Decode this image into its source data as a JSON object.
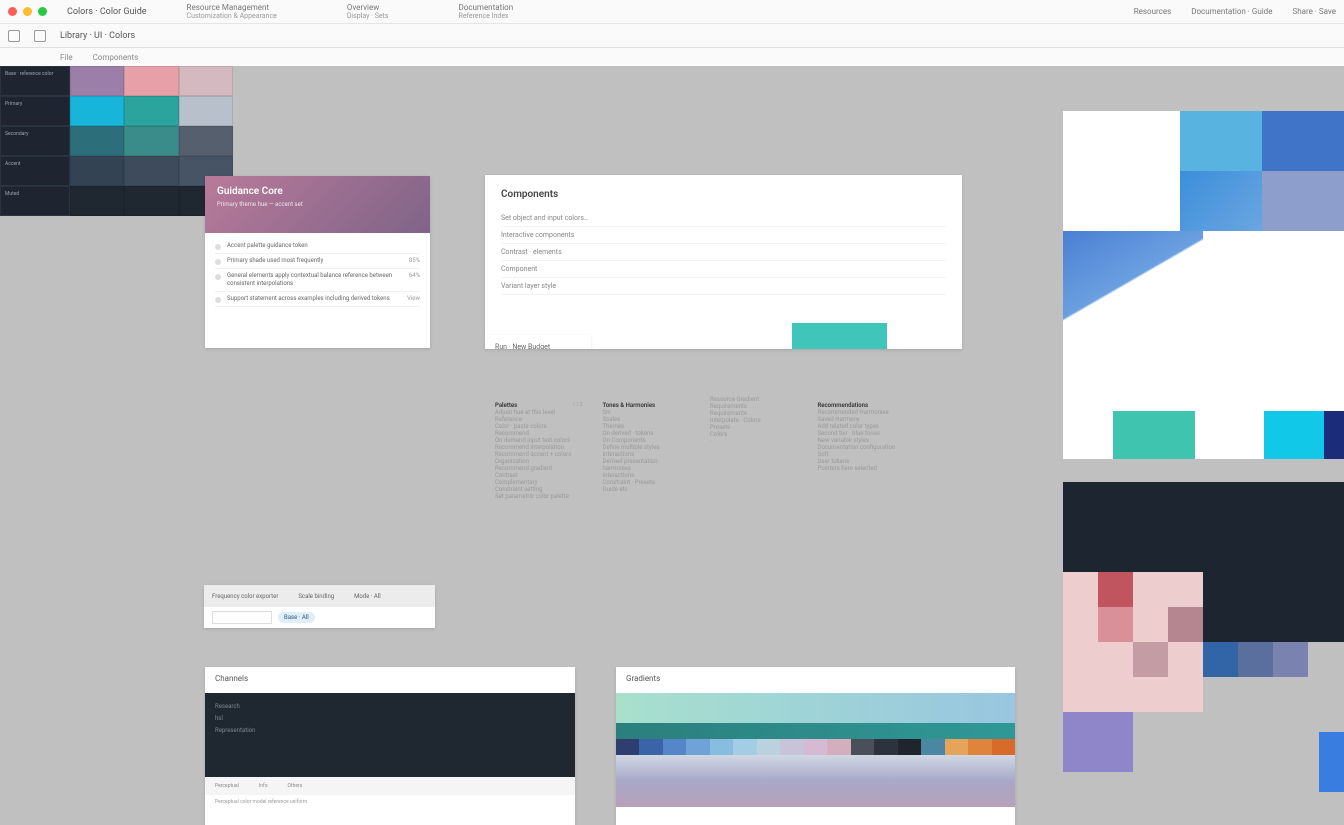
{
  "window": {
    "tab_name": "Colors · Color Guide",
    "crumbs": [
      {
        "t": "Resource Management",
        "s": "Customization & Appearance"
      },
      {
        "t": "Overview",
        "s": "Display · Sets"
      },
      {
        "t": "Documentation",
        "s": "Reference Index"
      }
    ],
    "right_actions": [
      "Resources",
      "Documentation · Guide",
      "Share · Save"
    ],
    "doc_title": "Library · UI · Colors",
    "toolbar_tabs": [
      "File",
      "Components"
    ]
  },
  "cardA": {
    "title": "Guidance Core",
    "subtitle": "Primary theme hue — accent set",
    "rows": [
      {
        "t": "Accent palette guidance token",
        "v": ""
      },
      {
        "t": "Primary shade used most frequently",
        "v": "85%"
      },
      {
        "t": "General elements apply contextual balance reference between consistent interpolations",
        "v": "64%"
      },
      {
        "t": "Support statement across examples including derived tokens",
        "v": "View"
      }
    ]
  },
  "cardB": {
    "title": "Components",
    "lines": [
      "Set object and input colors…",
      "Interactive components",
      "Contrast · elements",
      "Component",
      "Variant layer style"
    ],
    "tab": "Run · New Budget"
  },
  "cols": {
    "c1_h1": "Palettes",
    "c1_badge": "1 / 3",
    "c1": [
      "Adjust hue at this level",
      "Reference",
      "Color · paste colors",
      "Recommend",
      "On demand input text colors",
      "Recommend interpolation",
      "Recommend accent + colors",
      "Organization",
      "Recommend gradient",
      "Contrast",
      "Complementary",
      "Constraint setting",
      "Set parametric color palette"
    ],
    "c2_h1": "Tones & Harmonies",
    "c2": [
      "Src",
      "Scales",
      "Themes",
      "On derived · tokens",
      "On Components",
      "Define multiple styles",
      "Interactions",
      "Derived presentation · harmonies",
      "Interactions",
      "Constraint · Presets",
      "Guide etc"
    ],
    "c3": [
      "Resource Gradient",
      "Requirements",
      "Requirements",
      "Interpolate · Colors",
      "Presets",
      "Colors",
      "·"
    ],
    "c4_h1": "Recommendations",
    "c4": [
      "Recommended Harmonies",
      "Saved Harmony",
      "Add related color types",
      "Second tier · blue tones",
      "New variable styles",
      "Documentation configuration",
      "Soft",
      "User tokens",
      "Pointers here selected"
    ]
  },
  "cardD": {
    "label1": "Frequency color exporter",
    "label2": "Scale binding",
    "label3": "Mode · All",
    "chip": "Base · All"
  },
  "cardE": {
    "title": "Channels",
    "lines": [
      "Research",
      "hsl",
      "Representation"
    ],
    "foot": [
      "Perceptual",
      "Info",
      "Others"
    ],
    "foot2": "Perceptual color model reference uniform"
  },
  "cardF": {
    "title": "Gradients",
    "swatches": [
      "#2e3e6e",
      "#3b63a8",
      "#5586c9",
      "#6fa3d8",
      "#89bde0",
      "#a3cde4",
      "#bcd1df",
      "#c9c2d8",
      "#d6b9d2",
      "#d3aebd",
      "#4a4f5a",
      "#2d333d",
      "#1f242d",
      "#4b86a3",
      "#e5a45a",
      "#e0843d",
      "#d96b2a"
    ]
  },
  "palette_grid": {
    "row_labels": [
      "Base · reference color",
      "Primary",
      "Secondary",
      "Accent",
      "Muted"
    ],
    "cells": [
      [
        "#2a3340",
        "#9b7fa8",
        "#e7a0a8",
        "#d4b9c0"
      ],
      [
        "#2a3340",
        "#17b5d9",
        "#2aa49c",
        "#b7c0cb"
      ],
      [
        "#2a3340",
        "#2c6e7a",
        "#3a8c8a",
        "#565f6e"
      ],
      [
        "#2a3340",
        "#344354",
        "#3d4b5c",
        "#465465"
      ],
      [
        "#2a3340",
        "#1f2731",
        "#1f2731",
        "#1f2731"
      ]
    ]
  }
}
